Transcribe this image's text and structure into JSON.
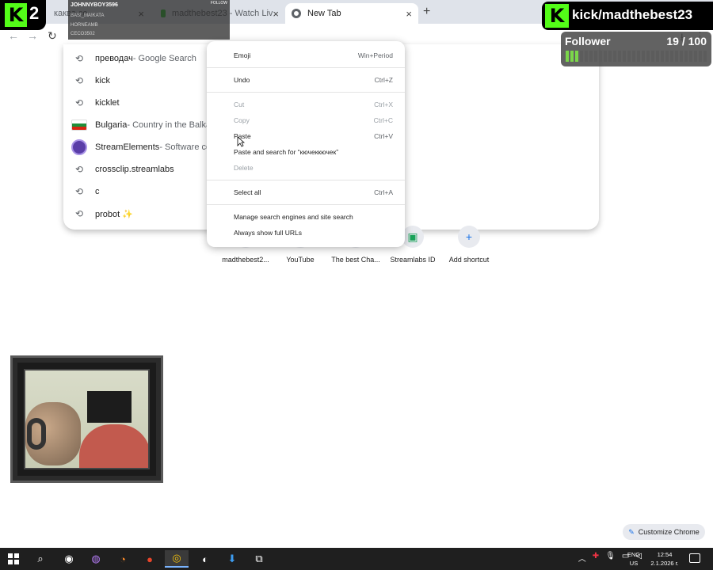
{
  "browser": {
    "tabs": [
      {
        "label": "какво се ...",
        "active": false
      },
      {
        "label": "madthebest23 - Watch Liv",
        "active": false
      },
      {
        "label": "New Tab",
        "active": true
      }
    ],
    "new_tab_symbol": "+",
    "close_symbol": "×"
  },
  "omnibox_suggestions": [
    {
      "icon": "history-icon",
      "text": "преводач",
      "desc": " - Google Search"
    },
    {
      "icon": "history-icon",
      "text": "kick",
      "desc": ""
    },
    {
      "icon": "history-icon",
      "text": "kicklet",
      "desc": ""
    },
    {
      "icon": "bulgaria-flag-icon",
      "text": "Bulgaria",
      "desc": " - Country in the Balkans"
    },
    {
      "icon": "streamelements-icon",
      "text": "StreamElements",
      "desc": " - Software comp"
    },
    {
      "icon": "history-icon",
      "text": "crossclip.streamlabs",
      "desc": ""
    },
    {
      "icon": "history-icon",
      "text": "c",
      "desc": ""
    },
    {
      "icon": "history-icon",
      "text": "probot ✨",
      "desc": ""
    }
  ],
  "shortcuts": [
    {
      "label": "madthebest2...",
      "icon": "site-icon"
    },
    {
      "label": "YouTube",
      "icon": "youtube-icon"
    },
    {
      "label": "The best Cha...",
      "icon": "site-icon"
    },
    {
      "label": "Streamlabs ID",
      "icon": "streamlabs-icon"
    },
    {
      "label": "Add shortcut",
      "icon": "plus-icon"
    }
  ],
  "context_menu": {
    "emoji": {
      "label": "Emoji",
      "shortcut": "Win+Period"
    },
    "undo": {
      "label": "Undo",
      "shortcut": "Ctrl+Z"
    },
    "cut": {
      "label": "Cut",
      "shortcut": "Ctrl+X"
    },
    "copy": {
      "label": "Copy",
      "shortcut": "Ctrl+C"
    },
    "paste": {
      "label": "Paste",
      "shortcut": "Ctrl+V"
    },
    "paste_search": {
      "label": "Paste and search for “кючеккючек”",
      "shortcut": ""
    },
    "delete": {
      "label": "Delete",
      "shortcut": ""
    },
    "select_all": {
      "label": "Select all",
      "shortcut": "Ctrl+A"
    },
    "manage_engines": {
      "label": "Manage search engines and site search",
      "shortcut": ""
    },
    "show_urls": {
      "label": "Always show full URLs",
      "shortcut": ""
    }
  },
  "stream_overlay": {
    "left_badge_letter": "K",
    "left_badge_count": "2",
    "chat_follow": "FOLLOW",
    "chat_lines": [
      "JOHNNYBOY3596",
      "BASI_MAIKATA",
      "HORNEAMB",
      "CECO3502"
    ],
    "right_letter": "K",
    "username": "kick/madthebest23",
    "follower_label": "Follower",
    "follower_count": "19 / 100",
    "follower_fraction": 0.19
  },
  "customize_label": "Customize Chrome",
  "taskbar": {
    "lang_top": "ENG",
    "lang_bottom": "US",
    "time": "12:54",
    "date": "2.1.2026 г."
  }
}
